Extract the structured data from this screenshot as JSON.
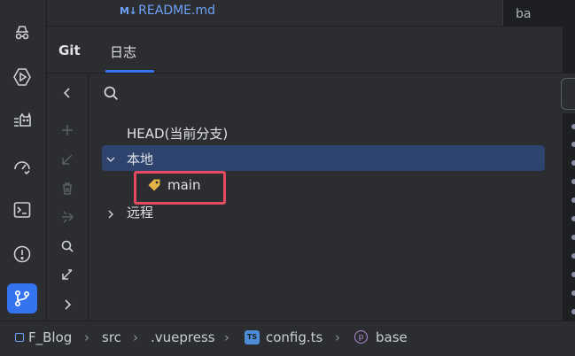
{
  "editor_tabs": {
    "active_file_icon": "markdown-icon",
    "active_file_icon_text": "M↓",
    "active_file": "README.md",
    "right_tab_label": "ba"
  },
  "tool_window": {
    "tabs": [
      {
        "label": "Git",
        "active": false
      },
      {
        "label": "日志",
        "active": true
      }
    ]
  },
  "left_toolbar": {
    "icons": [
      "incognito-icon",
      "run-icon",
      "cat-icon",
      "speed-icon",
      "terminal-icon",
      "problems-icon",
      "git-branch-icon"
    ],
    "active": "git-branch-icon",
    "accent_color": "#3574f0"
  },
  "mini_toolbar": {
    "icons": [
      "collapse-left-icon",
      "add-icon",
      "checkout-icon",
      "delete-icon",
      "merge-icon",
      "search-icon",
      "expand-arrows-icon",
      "expand-right-icon"
    ]
  },
  "branches": {
    "head_label": "HEAD(当前分支)",
    "local": {
      "label": "本地",
      "expanded": true,
      "selected": true
    },
    "local_branches": [
      {
        "name": "main",
        "icon": "tag-icon",
        "highlighted": true
      }
    ],
    "remote": {
      "label": "远程",
      "expanded": false
    },
    "selection_color": "#2e436e",
    "highlight_color": "#e84a5f"
  },
  "breadcrumb": {
    "items": [
      {
        "label": "F_Blog",
        "icon": "module-icon"
      },
      {
        "label": "src",
        "icon": ""
      },
      {
        "label": ".vuepress",
        "icon": ""
      },
      {
        "label": "config.ts",
        "icon": "typescript-icon",
        "icon_text": "TS"
      },
      {
        "label": "base",
        "icon": "property-icon",
        "icon_text": "p"
      }
    ]
  }
}
